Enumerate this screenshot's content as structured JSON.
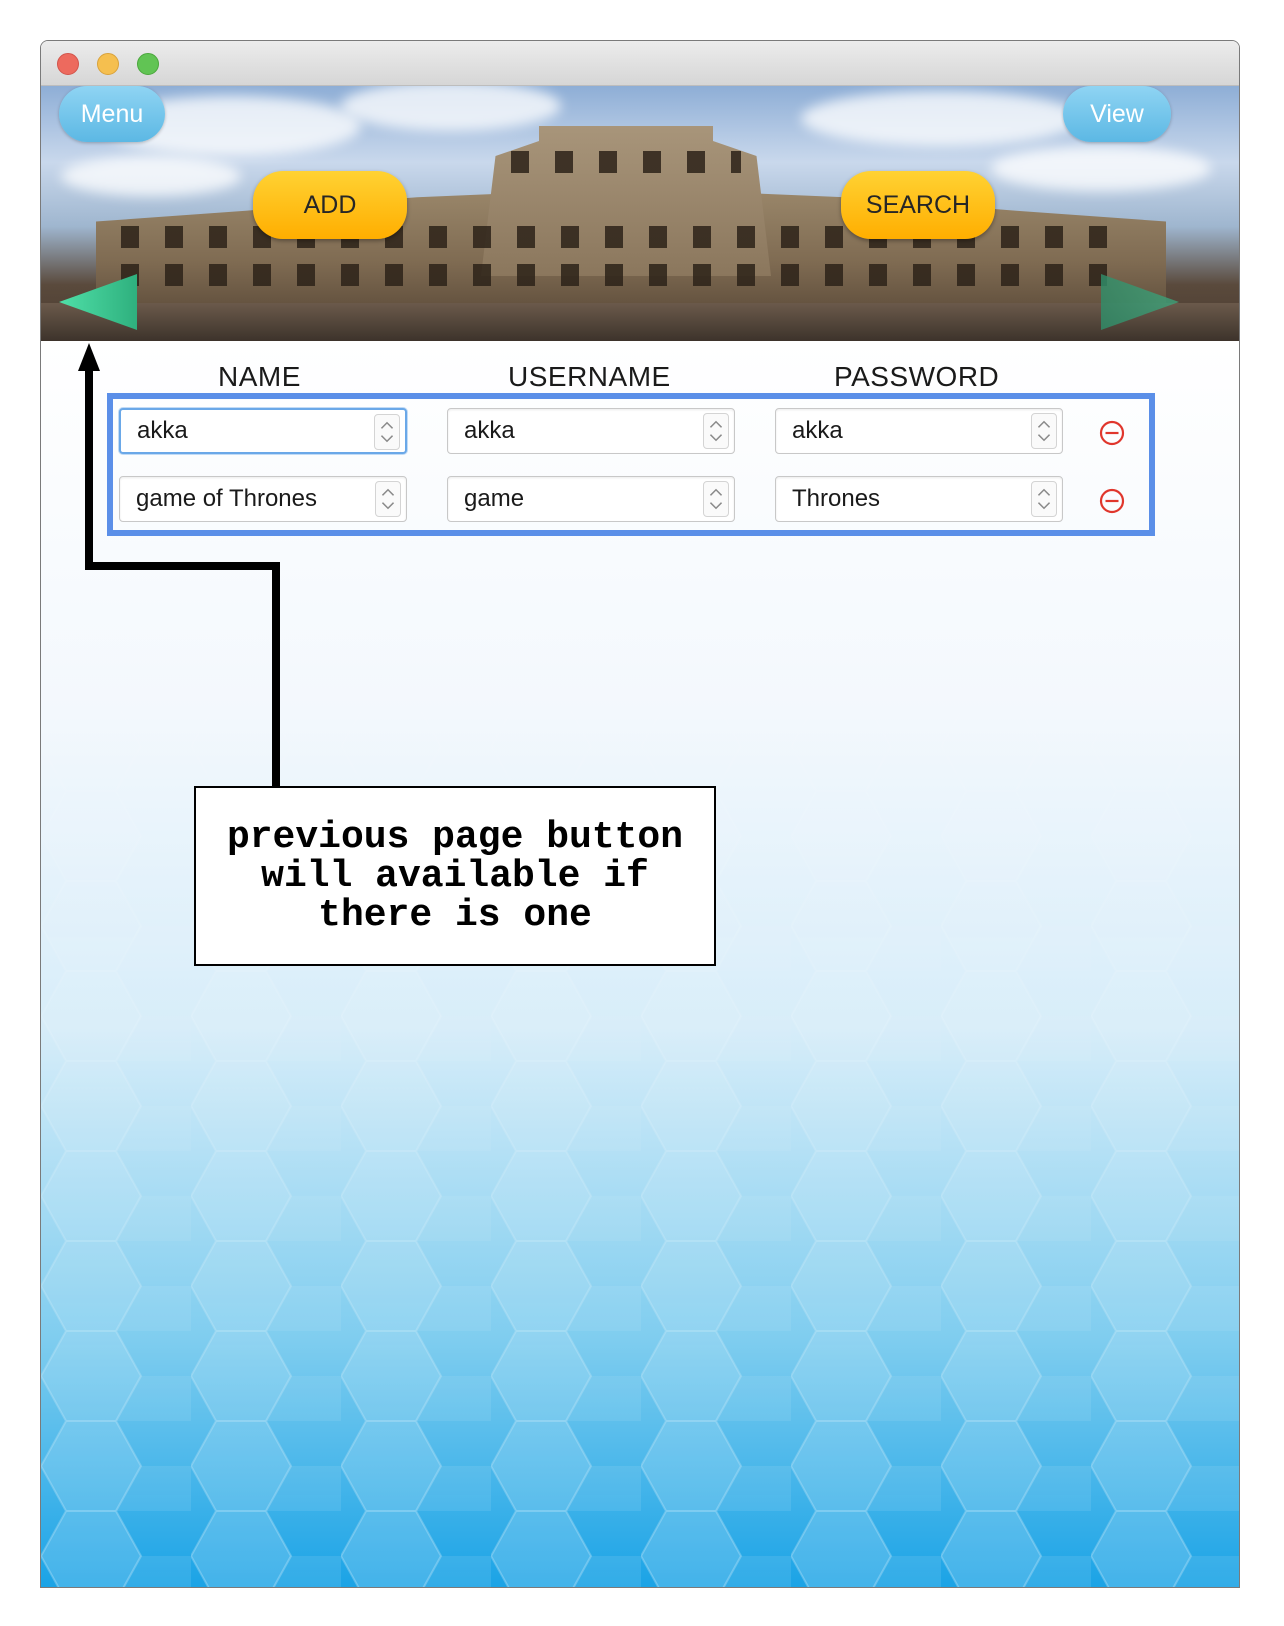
{
  "window": {
    "controls": [
      "close",
      "minimize",
      "zoom"
    ]
  },
  "banner": {
    "menu_label": "Menu",
    "view_label": "View",
    "add_label": "ADD",
    "search_label": "SEARCH",
    "prev_icon": "left-triangle-arrow",
    "next_icon": "right-triangle-arrow"
  },
  "table": {
    "headers": [
      "NAME",
      "USERNAME",
      "PASSWORD"
    ],
    "rows": [
      {
        "name": "akka",
        "username": "akka",
        "password": "akka"
      },
      {
        "name": "game of Thrones",
        "username": "game",
        "password": "Thrones"
      }
    ]
  },
  "annotation": {
    "text": "previous page button will available if there is one"
  },
  "colors": {
    "accent_blue": "#5b8fe8",
    "button_orange": "#ffae00",
    "button_blue": "#5cb8e4",
    "remove_red": "#e0362c",
    "arrow_green": "#3dd68f"
  }
}
